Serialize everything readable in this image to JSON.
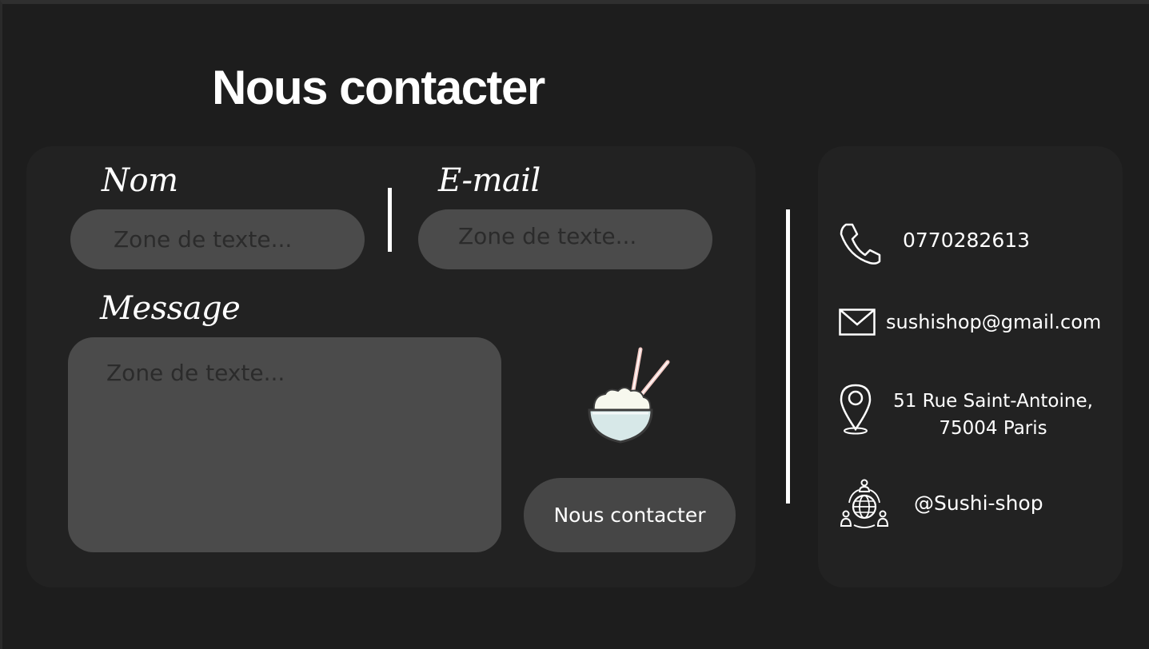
{
  "page": {
    "title": "Nous contacter"
  },
  "form": {
    "name_label": "Nom",
    "name_placeholder": "Zone de texte...",
    "email_label": "E-mail",
    "email_placeholder": "Zone de texte...",
    "message_label": "Message",
    "message_placeholder": "Zone de texte...",
    "submit_label": "Nous contacter",
    "illustration": "rice-bowl-icon"
  },
  "contact": {
    "phone": "0770282613",
    "email": "sushishop@gmail.com",
    "address_line1": "51 Rue Saint-Antoine,",
    "address_line2": "75004 Paris",
    "social": "@Sushi-shop",
    "icons": [
      "phone-icon",
      "mail-icon",
      "location-pin-icon",
      "social-network-icon"
    ]
  },
  "colors": {
    "background": "#1d1d1d",
    "card": "#222222",
    "field": "#4b4b4b",
    "button": "#464646",
    "text": "#ffffff"
  }
}
